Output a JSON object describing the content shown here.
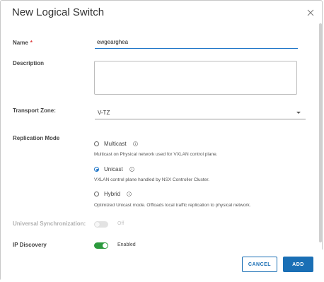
{
  "dialog": {
    "title": "New Logical Switch"
  },
  "form": {
    "name": {
      "label": "Name",
      "required_mark": "*",
      "value": "ewgearghea"
    },
    "description": {
      "label": "Description",
      "value": ""
    },
    "transport_zone": {
      "label": "Transport Zone:",
      "value": "V-TZ"
    },
    "replication": {
      "label": "Replication Mode",
      "options": [
        {
          "label": "Multicast",
          "hint": "Multicast on Physical network used for VXLAN control plane.",
          "selected": false
        },
        {
          "label": "Unicast",
          "hint": "VXLAN control plane handled by NSX Controller Cluster.",
          "selected": true
        },
        {
          "label": "Hybrid",
          "hint": "Optimized Unicast mode. Offloads local traffic replication to physical network.",
          "selected": false
        }
      ]
    },
    "universal_sync": {
      "label": "Universal Synchronization:",
      "state": "Off",
      "enabled": false
    },
    "ip_discovery": {
      "label": "IP Discovery",
      "state": "Enabled",
      "enabled": true
    }
  },
  "footer": {
    "cancel_label": "CANCEL",
    "add_label": "ADD"
  },
  "colors": {
    "accent": "#1a6fb5",
    "toggle_on": "#2c9a3d",
    "required": "#dd3333"
  }
}
